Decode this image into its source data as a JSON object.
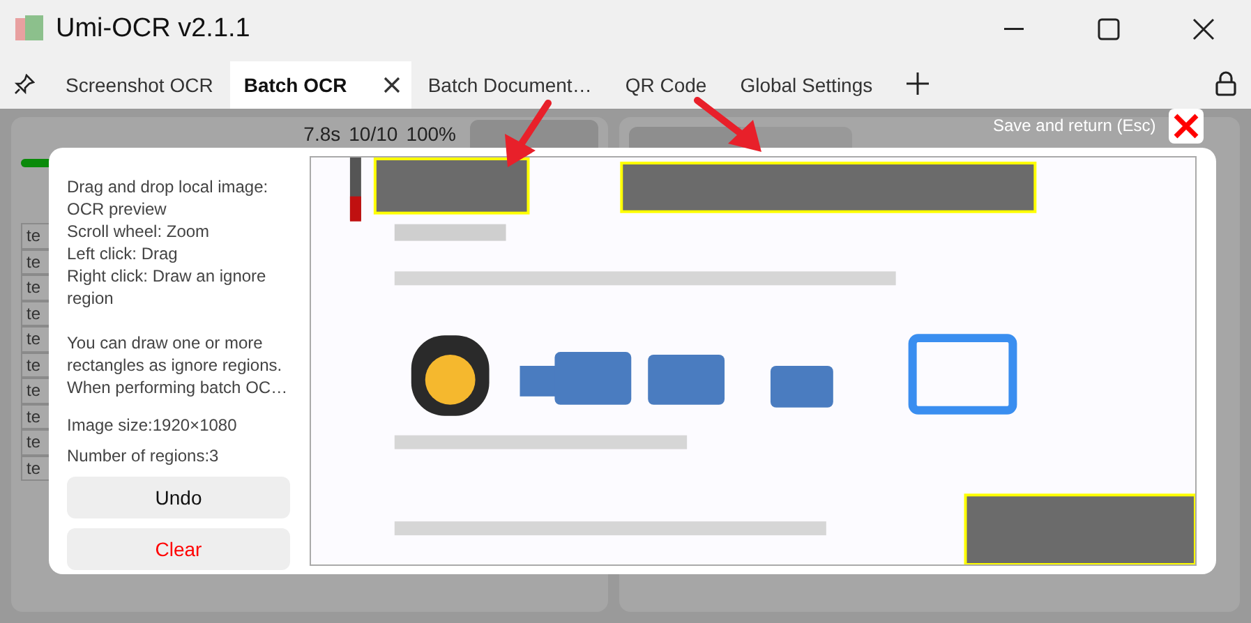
{
  "window": {
    "title": "Umi-OCR v2.1.1"
  },
  "tabs": [
    {
      "label": "Screenshot OCR",
      "selected": false
    },
    {
      "label": "Batch OCR",
      "selected": true
    },
    {
      "label": "Batch Document…",
      "selected": false
    },
    {
      "label": "QR Code",
      "selected": false
    },
    {
      "label": "Global Settings",
      "selected": false
    }
  ],
  "task_bar": {
    "time": "7.8s",
    "count": "10/10",
    "percent": "100%",
    "progress": {
      "level": 1
    }
  },
  "file_list": {
    "rows": [
      "te",
      "te",
      "te",
      "te",
      "te",
      "te",
      "te",
      "te",
      "te",
      "te"
    ]
  },
  "settings_panel": {
    "tabs": [
      {
        "selected": true
      },
      {
        "selected": false
      }
    ]
  },
  "dialog": {
    "save_hint": "Save and return (Esc)",
    "instructions": [
      [
        "Drag and drop local image:",
        "OCR preview",
        "Scroll wheel: Zoom",
        "Left click: Drag",
        "Right click: Draw an ignore",
        "region"
      ],
      [
        "You can draw one or more",
        "rectangles as ignore regions.",
        "When performing batch OC…"
      ]
    ],
    "image_size": "Image size:1920×1080",
    "region_count": "Number of regions:3",
    "buttons": [
      {
        "label": "Undo",
        "kind": "normal"
      },
      {
        "label": "Clear",
        "kind": "danger"
      }
    ]
  }
}
